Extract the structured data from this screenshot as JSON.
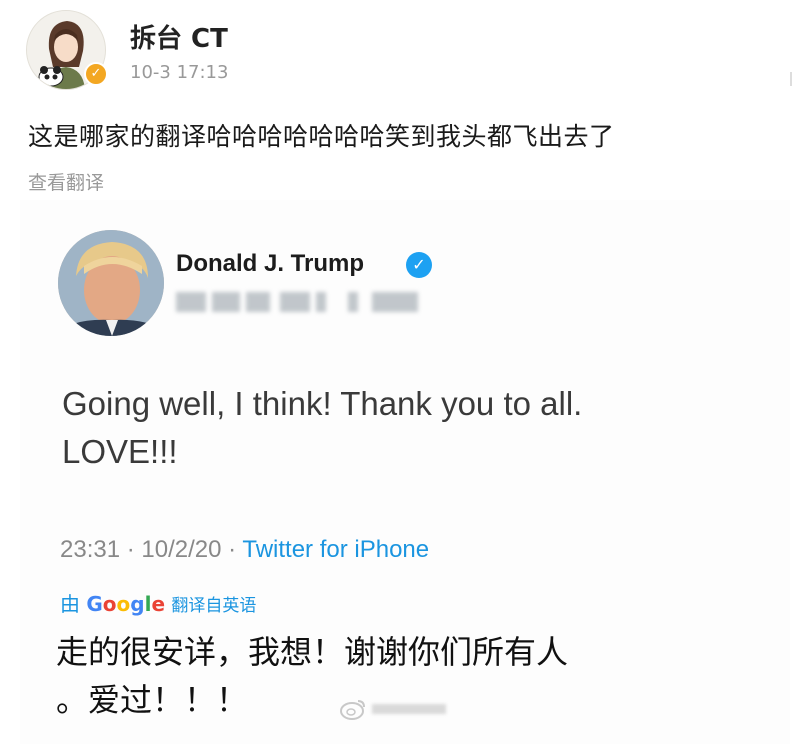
{
  "post": {
    "author": "拆台 CT",
    "time": "10-3 17:13",
    "text": "这是哪家的翻译哈哈哈哈哈哈哈笑到我头都飞出去了",
    "view_translation": "查看翻译"
  },
  "tweet": {
    "name": "Donald J. Trump",
    "body_line1": "Going well, I think! Thank you to all.",
    "body_line2": "LOVE!!!",
    "timestamp": "23:31 · 10/2/20 · ",
    "source": "Twitter for iPhone",
    "translated_by_prefix": "由",
    "translated_by_suffix": "翻译自英语",
    "translated_line1": "走的很安详，我想！谢谢你们所有人",
    "translated_line2": "。爱过！！！"
  },
  "icons": {
    "verified_badge": "verified-icon",
    "tweet_verified": "blue-check-icon",
    "watermark": "weibo-logo-icon"
  },
  "colors": {
    "weibo_badge": "#f3a722",
    "twitter_blue": "#1da1f2",
    "link_blue": "#1b95e0",
    "secondary_text": "#999999"
  }
}
